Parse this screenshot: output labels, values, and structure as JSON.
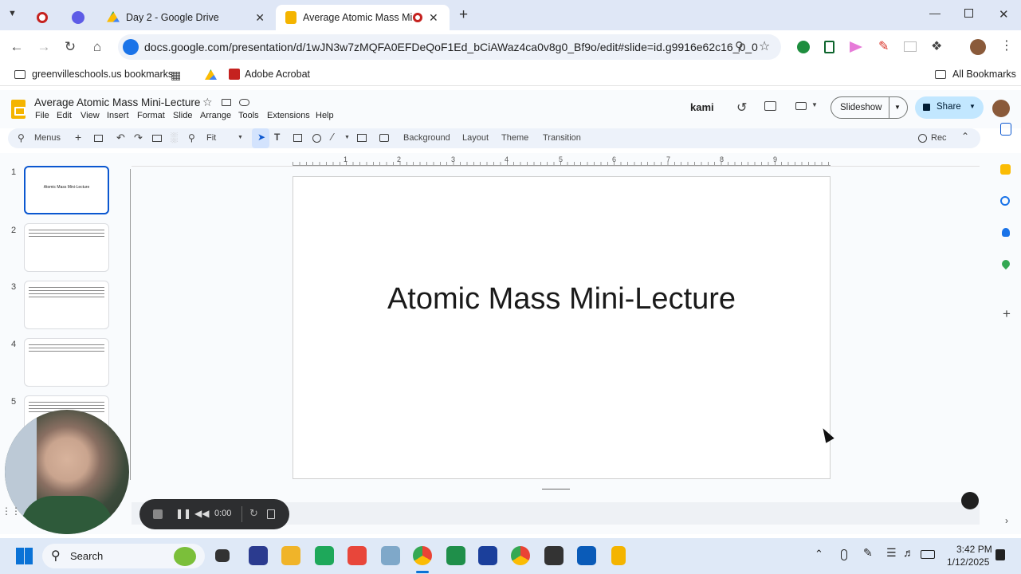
{
  "browser": {
    "tabs": [
      {
        "title": "",
        "icon": "record-icon"
      },
      {
        "title": "",
        "icon": "extension-sparkle-icon"
      },
      {
        "title": "Day 2 - Google Drive",
        "icon": "google-drive-icon"
      },
      {
        "title": "Average Atomic Mass Mini-",
        "icon": "google-slides-icon"
      }
    ],
    "new_tab_label": "+",
    "url": "docs.google.com/presentation/d/1wJN3w7zMQFA0EFDeQoF1Ed_bCiAWaz4ca0v8g0_Bf9o/edit#slide=id.g9916e62c16_0_0",
    "bookmarks": [
      {
        "label": "greenvilleschools.us bookmarks"
      },
      {
        "label": "Adobe Acrobat"
      }
    ],
    "all_bookmarks_label": "All Bookmarks"
  },
  "slides_app": {
    "title": "Average Atomic Mass Mini-Lecture",
    "menus": [
      "File",
      "Edit",
      "View",
      "Insert",
      "Format",
      "Slide",
      "Arrange",
      "Tools",
      "Extensions",
      "Help"
    ],
    "kami_label": "kami",
    "slideshow_label": "Slideshow",
    "share_label": "Share",
    "toolbar": {
      "menus_label": "Menus",
      "zoom_label": "Fit",
      "background_label": "Background",
      "layout_label": "Layout",
      "theme_label": "Theme",
      "transition_label": "Transition",
      "rec_label": "Rec"
    },
    "ruler_marks": [
      "1",
      "2",
      "3",
      "4",
      "5",
      "6",
      "7",
      "8",
      "9"
    ],
    "slide_numbers": [
      "1",
      "2",
      "3",
      "4",
      "5"
    ],
    "thumb1_title": "Atomic Mass Mini-Lecture",
    "current_slide_title": "Atomic Mass Mini-Lecture"
  },
  "recording": {
    "timer": "0:00"
  },
  "taskbar": {
    "search_label": "Search",
    "time": "3:42 PM",
    "date": "1/12/2025"
  },
  "colors": {
    "accent": "#0b57d0",
    "slides_yellow": "#f4b400",
    "tab_strip": "#dfe7f6"
  }
}
